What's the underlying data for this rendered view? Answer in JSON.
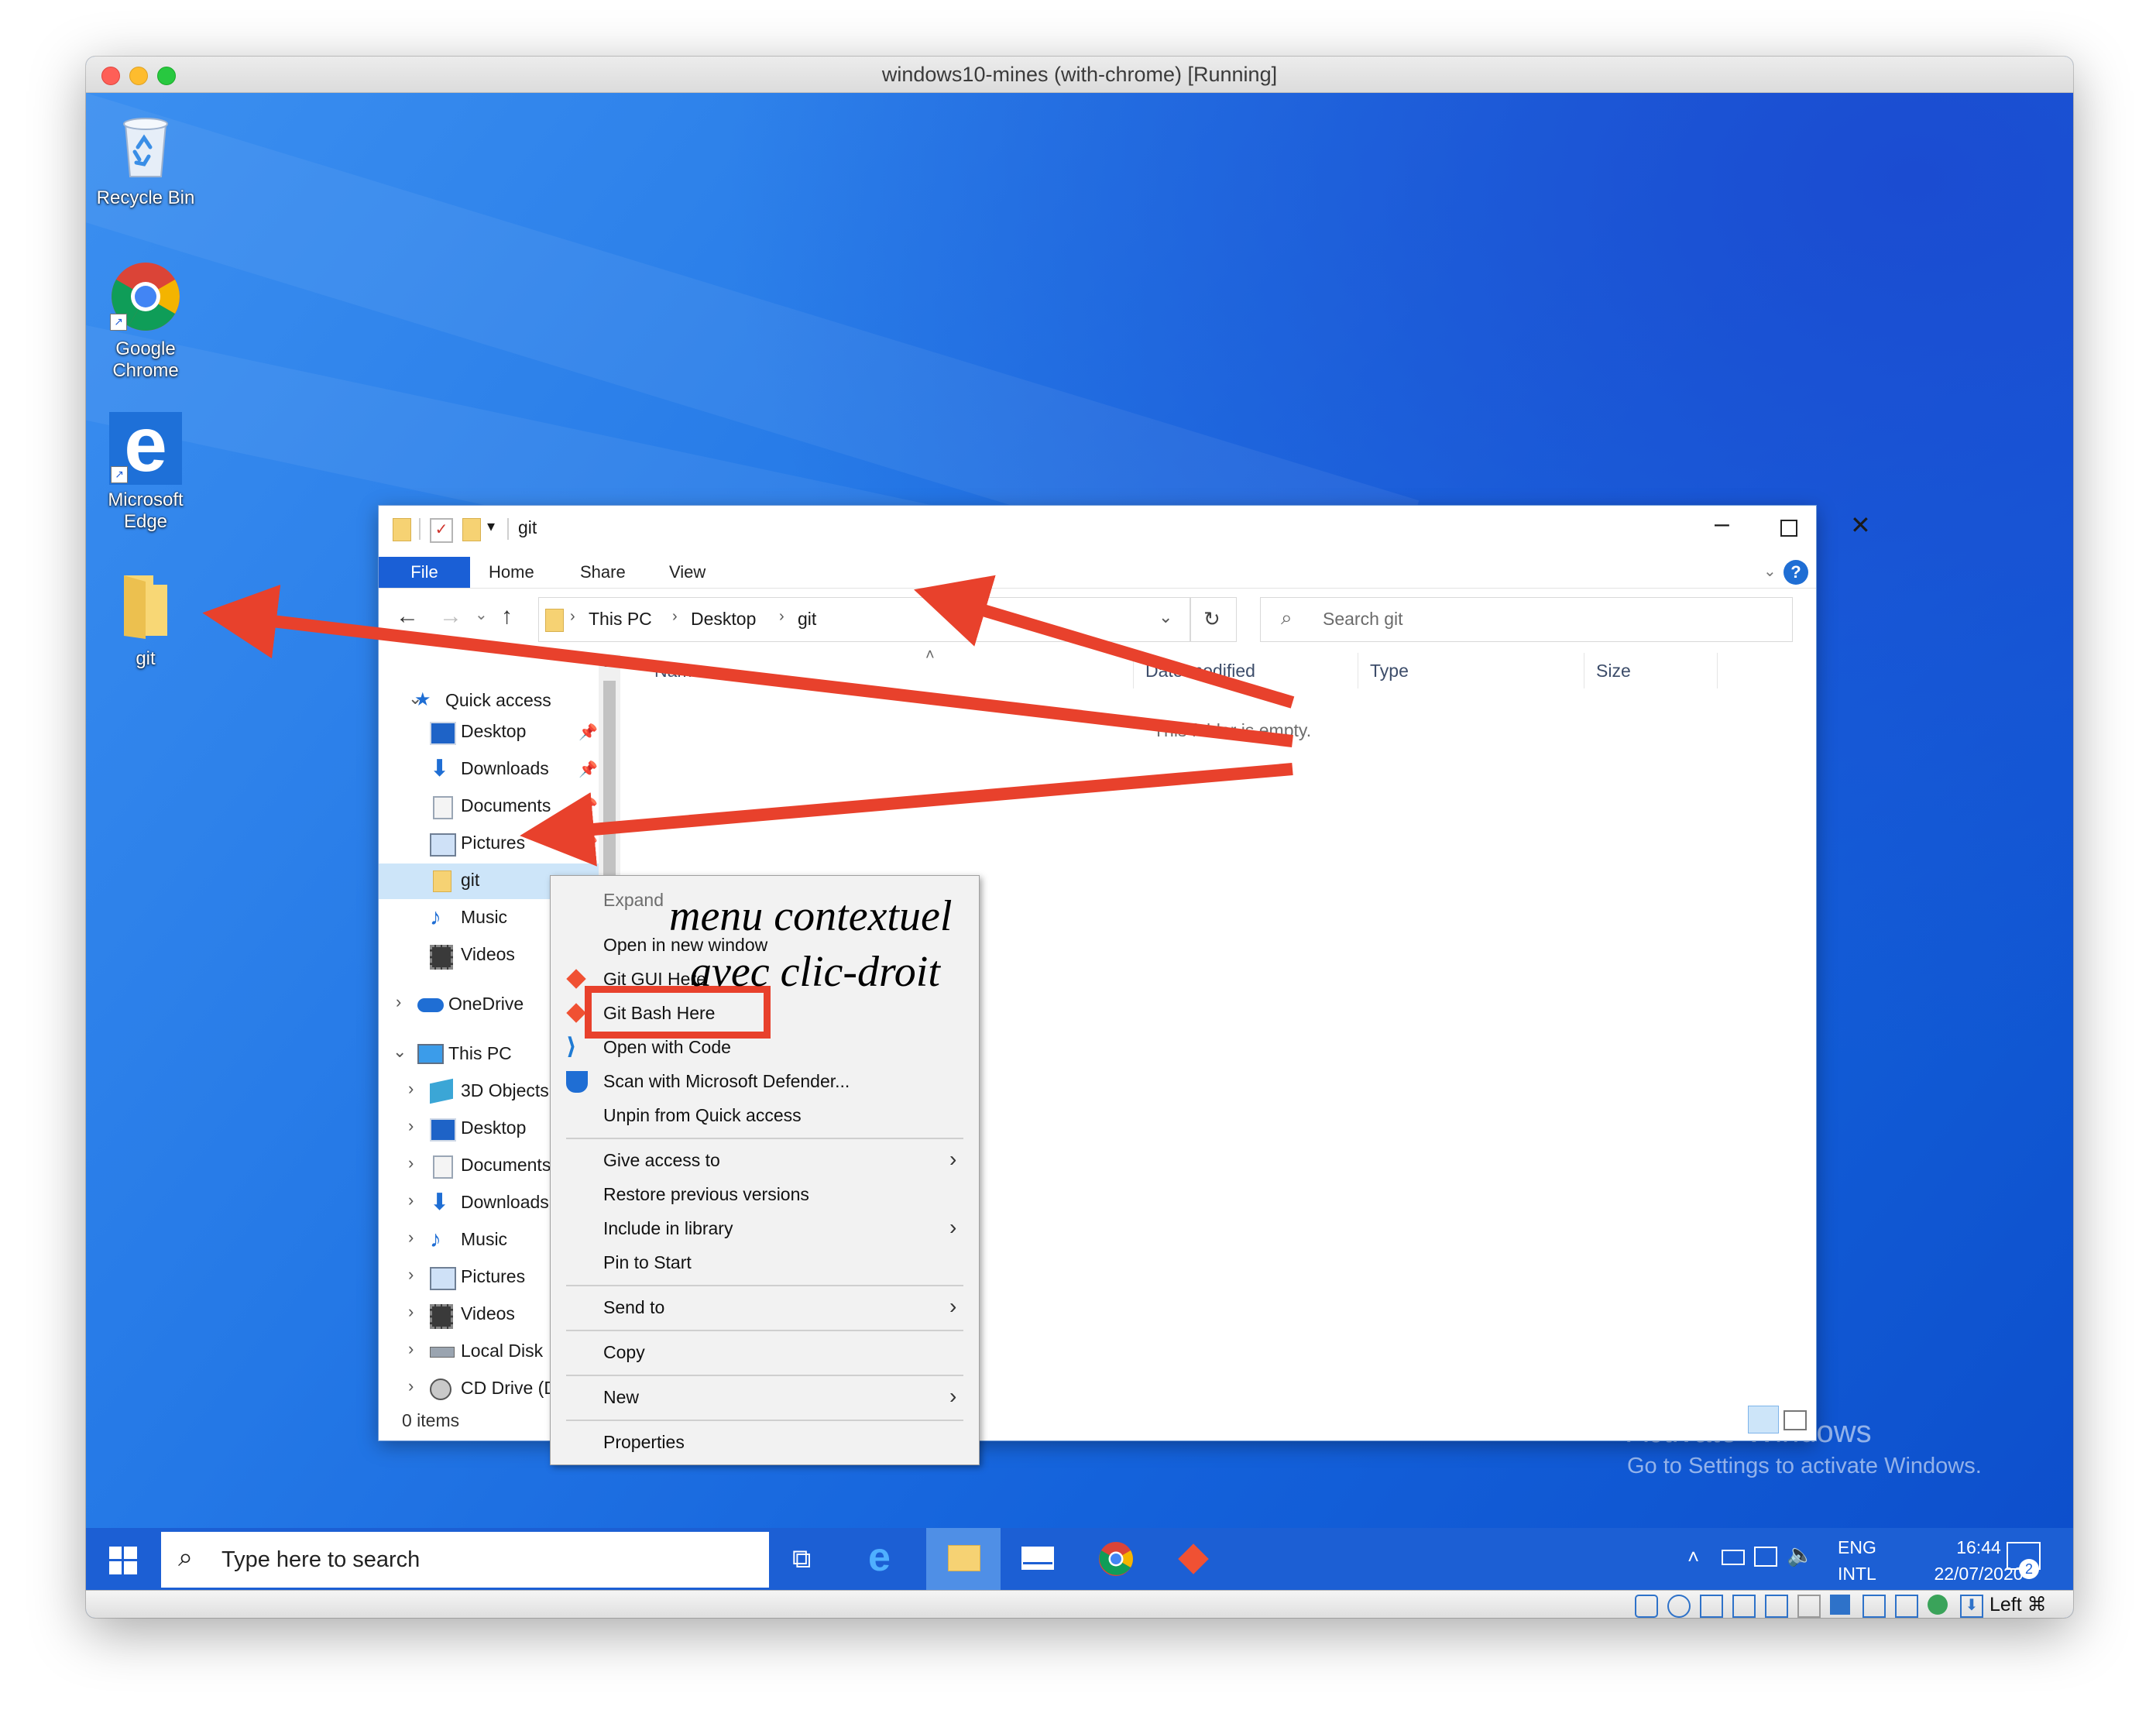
{
  "host_window": {
    "title": "windows10-mines (with-chrome) [Running]"
  },
  "desktop": {
    "icons": [
      {
        "name": "recycle-bin",
        "label": "Recycle Bin"
      },
      {
        "name": "google-chrome",
        "label": "Google Chrome",
        "line1": "Google",
        "line2": "Chrome"
      },
      {
        "name": "microsoft-edge",
        "label": "Microsoft Edge",
        "line1": "Microsoft",
        "line2": "Edge"
      },
      {
        "name": "git-folder",
        "label": "git"
      }
    ],
    "watermark": {
      "title": "Activate Windows",
      "subtitle": "Go to Settings to activate Windows."
    }
  },
  "explorer": {
    "title": "git",
    "ribbon_tabs": [
      "File",
      "Home",
      "Share",
      "View"
    ],
    "breadcrumb": [
      "This PC",
      "Desktop",
      "git"
    ],
    "search_placeholder": "Search git",
    "columns": [
      "Name",
      "Date modified",
      "Type",
      "Size"
    ],
    "empty_message": "This folder is empty.",
    "status": "0 items",
    "nav": {
      "quick_access_label": "Quick access",
      "quick_access": [
        "Desktop",
        "Downloads",
        "Documents",
        "Pictures",
        "git",
        "Music",
        "Videos"
      ],
      "onedrive": "OneDrive",
      "this_pc": "This PC",
      "this_pc_items": [
        "3D Objects",
        "Desktop",
        "Documents",
        "Downloads",
        "Music",
        "Pictures",
        "Videos",
        "Local Disk",
        "CD Drive (D"
      ]
    }
  },
  "context_menu": {
    "items": [
      {
        "label": "Expand"
      },
      {
        "label": "Open in new window"
      },
      {
        "label": "Git GUI Here"
      },
      {
        "label": "Git Bash Here",
        "highlighted": true
      },
      {
        "label": "Open with Code"
      },
      {
        "label": "Scan with Microsoft Defender..."
      },
      {
        "label": "Unpin from Quick access"
      },
      {
        "label": "Give access to",
        "submenu": true
      },
      {
        "label": "Restore previous versions"
      },
      {
        "label": "Include in library",
        "submenu": true
      },
      {
        "label": "Pin to Start"
      },
      {
        "label": "Send to",
        "submenu": true
      },
      {
        "label": "Copy"
      },
      {
        "label": "New",
        "submenu": true
      },
      {
        "label": "Properties"
      }
    ]
  },
  "annotation": {
    "line1": "menu contextuel",
    "line2": "avec clic-droit",
    "arrow_color": "#e8412c",
    "highlight_color": "#e8412c"
  },
  "taskbar": {
    "search_placeholder": "Type here to search",
    "language": "ENG",
    "layout": "INTL",
    "time": "16:44",
    "date": "22/07/2020",
    "notification_count": "2"
  },
  "vbox_status": {
    "host_key": "Left ⌘"
  }
}
